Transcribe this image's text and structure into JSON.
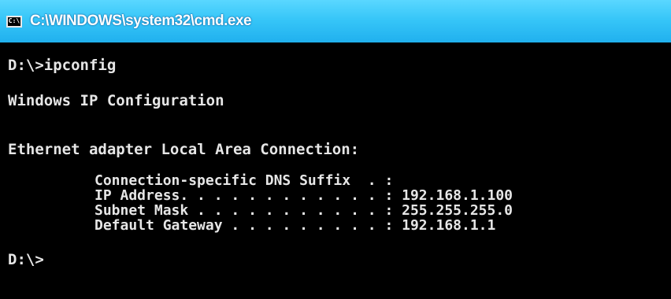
{
  "window": {
    "title": "C:\\WINDOWS\\system32\\cmd.exe",
    "icon": "cmd-icon",
    "icon_glyph": "C:\\"
  },
  "console": {
    "lines": [
      "D:\\>ipconfig",
      "Windows IP Configuration",
      "Ethernet adapter Local Area Connection:"
    ],
    "entries": [
      "Connection-specific DNS Suffix  . :",
      "IP Address. . . . . . . . . . . . : 192.168.1.100",
      "Subnet Mask . . . . . . . . . . . : 255.255.255.0",
      "Default Gateway . . . . . . . . . : 192.168.1.1"
    ],
    "prompt": "D:\\>"
  },
  "colors": {
    "titlebar": "#37c6f8",
    "console_bg": "#000000",
    "console_text": "#e6e6e6"
  }
}
